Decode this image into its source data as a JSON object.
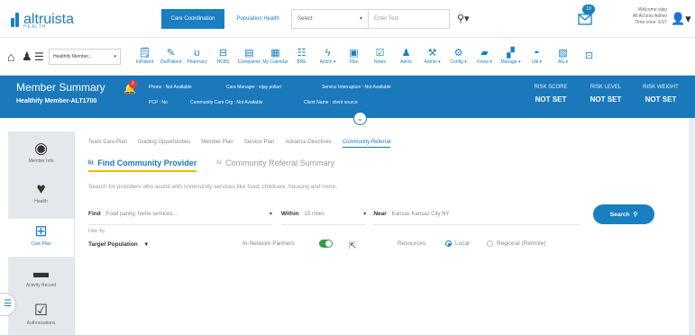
{
  "header": {
    "logo_text": "altruista",
    "logo_sub": "HEALTH",
    "tabs": [
      {
        "label": "Care Coordination",
        "active": true
      },
      {
        "label": "Population Health",
        "active": false
      }
    ],
    "select_value": "Select",
    "search_placeholder": "Enter Text",
    "mail_badge": "10",
    "welcome_lines": [
      "Welcome vijay",
      "All Access Admin",
      "Time zone: EST"
    ]
  },
  "toolbar": {
    "member_select": "Healthify Member...",
    "tools": [
      {
        "label": "InPatient",
        "icon": "inpatient-icon",
        "glyph": "🗒"
      },
      {
        "label": "OutPatient",
        "icon": "outpatient-icon",
        "glyph": "✎"
      },
      {
        "label": "Pharmacy",
        "icon": "pharmacy-icon",
        "glyph": "ʊ"
      },
      {
        "label": "HCBS",
        "icon": "hcbs-icon",
        "glyph": "⊟"
      },
      {
        "label": "Complaints",
        "icon": "complaints-icon",
        "glyph": "▤"
      },
      {
        "label": "My Calendar",
        "icon": "calendar-icon",
        "glyph": "▦"
      },
      {
        "label": "BRE",
        "icon": "bre-icon",
        "glyph": "☷"
      },
      {
        "label": "Action ▾",
        "icon": "action-icon",
        "glyph": "ϟ"
      },
      {
        "label": "Plan",
        "icon": "plan-icon",
        "glyph": "▣"
      },
      {
        "label": "Notes",
        "icon": "notes-icon",
        "glyph": "☑"
      },
      {
        "label": "Alerts",
        "icon": "alerts-icon",
        "glyph": "♟"
      },
      {
        "label": "Admin ▾",
        "icon": "admin-icon",
        "glyph": "⚒"
      },
      {
        "label": "Config ▾",
        "icon": "config-icon",
        "glyph": "⚙"
      },
      {
        "label": "Know ▾",
        "icon": "know-icon",
        "glyph": "▰"
      },
      {
        "label": "Manage ▾",
        "icon": "manage-icon",
        "glyph": "▞"
      },
      {
        "label": "Util ▾",
        "icon": "util-icon",
        "glyph": "◓"
      },
      {
        "label": "AG ▾",
        "icon": "ag-icon",
        "glyph": "▧"
      }
    ]
  },
  "summary": {
    "title": "Member Summary",
    "member": "Healthify Member-ALT1700",
    "bell_badge": "1",
    "info": {
      "phone": "Phone : Not Available",
      "care_manager": "Care Manager : vijay pollari",
      "service_interruption": "Service Interruption : Not Available",
      "pcp": "PCP : No",
      "community_care_org": "Community Care Org : Not Available",
      "client_name": "Client Name : client source"
    },
    "risks": [
      {
        "label": "RISK SCORE",
        "value": "NOT SET"
      },
      {
        "label": "RISK LEVEL",
        "value": "NOT SET"
      },
      {
        "label": "RISK WEIGHT",
        "value": "NOT SET"
      }
    ]
  },
  "sidebar": {
    "items": [
      {
        "label": "Member Info",
        "icon": "member-info-icon"
      },
      {
        "label": "Health",
        "icon": "health-icon"
      },
      {
        "label": "Care Plan",
        "icon": "care-plan-icon"
      },
      {
        "label": "Activity Record",
        "icon": "activity-record-icon"
      },
      {
        "label": "Authorizations",
        "icon": "authorizations-icon"
      }
    ]
  },
  "main": {
    "subtabs": [
      "Team Care Plan",
      "Guiding Opportunities",
      "Member Plan",
      "Service Plan",
      "Advance Directives",
      "Community Referral"
    ],
    "provider_tabs": [
      "Find Community Provider",
      "Community Referral Summary"
    ],
    "description": "Search for providers who assist with community services like food, childcare, housing and more.",
    "find_label": "Find",
    "find_placeholder": "Food pantry, home services...",
    "within_label": "Within",
    "within_value": "15 miles",
    "near_label": "Near",
    "near_value": "Kansas Kansas City NY",
    "search_button": "Search",
    "filter_by": "Filter By",
    "target_population": "Target Population",
    "in_network": "In-Network Partners",
    "resources_label": "Resources",
    "resource_options": [
      "Local",
      "Regional (Remote)"
    ]
  }
}
